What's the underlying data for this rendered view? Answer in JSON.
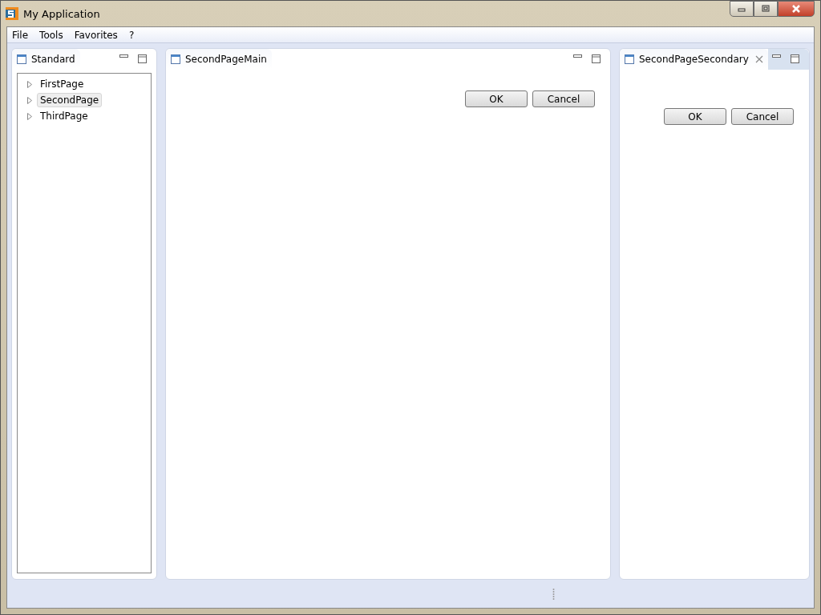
{
  "window": {
    "title": "My Application"
  },
  "menu": [
    "File",
    "Tools",
    "Favorites",
    "?"
  ],
  "views": [
    {
      "kind": "tree",
      "title": "Standard",
      "closable": false,
      "items": [
        {
          "label": "FirstPage",
          "selected": false
        },
        {
          "label": "SecondPage",
          "selected": true
        },
        {
          "label": "ThirdPage",
          "selected": false
        }
      ]
    },
    {
      "kind": "form",
      "title": "SecondPageMain",
      "closable": false,
      "buttons": [
        "OK",
        "Cancel"
      ]
    },
    {
      "kind": "form",
      "title": "SecondPageSecondary",
      "closable": true,
      "buttons": [
        "OK",
        "Cancel"
      ]
    }
  ]
}
